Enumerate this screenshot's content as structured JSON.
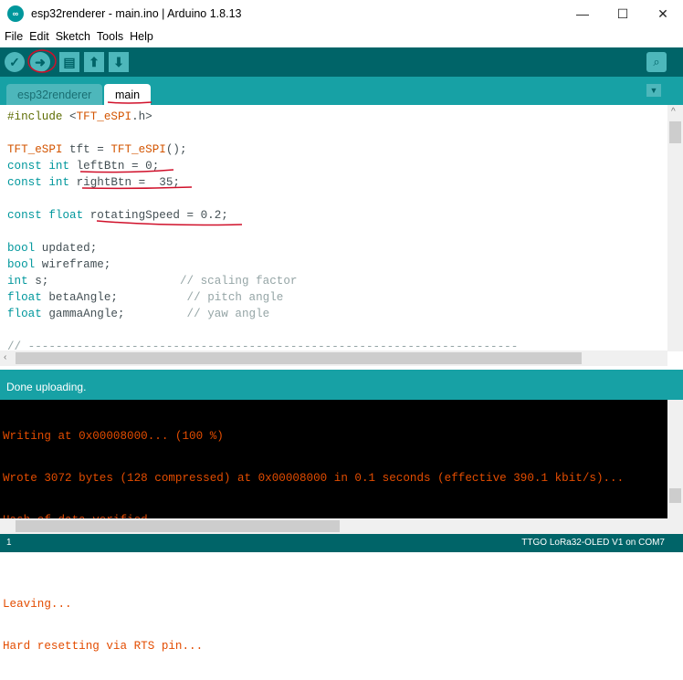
{
  "window": {
    "title": "esp32renderer - main.ino | Arduino 1.8.13",
    "app_icon": "∞",
    "minimize": "—",
    "maximize": "☐",
    "close": "✕"
  },
  "menu": [
    "File",
    "Edit",
    "Sketch",
    "Tools",
    "Help"
  ],
  "toolbar": {
    "verify": "✓",
    "upload": "➜",
    "new": "▤",
    "open": "⬆",
    "save": "⬇",
    "serial_monitor": "⌕"
  },
  "tabs": [
    {
      "label": "esp32renderer"
    },
    {
      "label": "main"
    }
  ],
  "tab_menu": "▼",
  "code": [
    [
      {
        "c": "pre",
        "t": "#include"
      },
      {
        "c": "pl",
        "t": " <"
      },
      {
        "c": "cls",
        "t": "TFT_eSPI"
      },
      {
        "c": "pl",
        "t": ".h>"
      }
    ],
    [],
    [
      {
        "c": "cls",
        "t": "TFT_eSPI"
      },
      {
        "c": "pl",
        "t": " tft = "
      },
      {
        "c": "cls",
        "t": "TFT_eSPI"
      },
      {
        "c": "pl",
        "t": "();"
      }
    ],
    [
      {
        "c": "kw",
        "t": "const int"
      },
      {
        "c": "pl",
        "t": " leftBtn = 0;"
      }
    ],
    [
      {
        "c": "kw",
        "t": "const int"
      },
      {
        "c": "pl",
        "t": " rightBtn =  35;"
      }
    ],
    [],
    [
      {
        "c": "kw",
        "t": "const float"
      },
      {
        "c": "pl",
        "t": " rotatingSpeed = 0.2;"
      }
    ],
    [],
    [
      {
        "c": "kw",
        "t": "bool"
      },
      {
        "c": "pl",
        "t": " updated;"
      }
    ],
    [
      {
        "c": "kw",
        "t": "bool"
      },
      {
        "c": "pl",
        "t": " wireframe;"
      }
    ],
    [
      {
        "c": "kw",
        "t": "int"
      },
      {
        "c": "pl",
        "t": " s;                   "
      },
      {
        "c": "cm",
        "t": "// scaling factor"
      }
    ],
    [
      {
        "c": "kw",
        "t": "float"
      },
      {
        "c": "pl",
        "t": " betaAngle;          "
      },
      {
        "c": "cm",
        "t": "// pitch angle"
      }
    ],
    [
      {
        "c": "kw",
        "t": "float"
      },
      {
        "c": "pl",
        "t": " gammaAngle;         "
      },
      {
        "c": "cm",
        "t": "// yaw angle"
      }
    ],
    [],
    [
      {
        "c": "cm",
        "t": "// -----------------------------------------------------------------------"
      }
    ]
  ],
  "status": "Done uploading.",
  "console": [
    "Writing at 0x00008000... (100 %)",
    "Wrote 3072 bytes (128 compressed) at 0x00008000 in 0.1 seconds (effective 390.1 kbit/s)...",
    "Hash of data verified.",
    "",
    "Leaving...",
    "Hard resetting via RTS pin..."
  ],
  "bottom": {
    "line": "1",
    "board": "TTGO LoRa32-OLED V1 on COM7"
  }
}
